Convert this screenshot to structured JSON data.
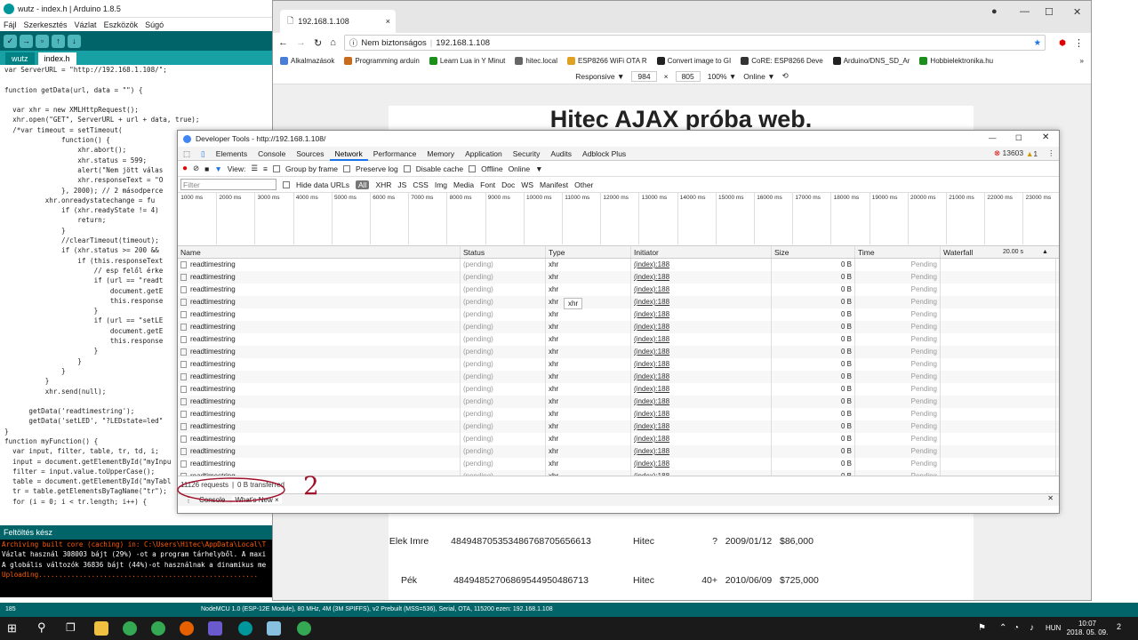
{
  "arduino": {
    "title": "wutz - index.h | Arduino 1.8.5",
    "menu": [
      "Fájl",
      "Szerkesztés",
      "Vázlat",
      "Eszközök",
      "Súgó"
    ],
    "tabs": [
      "wutz",
      "index.h"
    ],
    "code": [
      "var ServerURL = \"http://192.168.1.108/\";",
      "",
      "function getData(url, data = \"\") {",
      "",
      "  var xhr = new XMLHttpRequest();",
      "  xhr.open(\"GET\", ServerURL + url + data, true);",
      "  /*var timeout = setTimeout(",
      "              function() {",
      "                  xhr.abort();",
      "                  xhr.status = 599;",
      "                  alert(\"Nem jött válas",
      "                  xhr.responseText = \"O",
      "              }, 2000); // 2 másodperce",
      "          xhr.onreadystatechange = fu",
      "              if (xhr.readyState != 4)",
      "                  return;",
      "              }",
      "              //clearTimeout(timeout);",
      "              if (xhr.status >= 200 && ",
      "                  if (this.responseText",
      "                      // esp felől érke",
      "                      if (url == \"readt",
      "                          document.getE",
      "                          this.response",
      "                      }",
      "                      if (url == \"setLE",
      "                          document.getE",
      "                          this.response",
      "                      }",
      "                  }",
      "              }",
      "          }",
      "          xhr.send(null);",
      "",
      "      getData('readtimestring');",
      "      getData('setLED', \"?LEDstate=led\"",
      "}",
      "function myFunction() {",
      "  var input, filter, table, tr, td, i;",
      "  input = document.getElementById(\"myInpu",
      "  filter = input.value.toUpperCase();",
      "  table = document.getElementById(\"myTabl",
      "  tr = table.getElementsByTagName(\"tr\");",
      "  for (i = 0; i < tr.length; i++) {"
    ],
    "status_msg": "Feltöltés kész",
    "console": [
      "Archiving built core (caching) in: C:\\Users\\Hitec\\AppData\\Local\\T",
      "Vázlat használ 308003 bájt (29%) -ot a program tárhelyből. A maxi",
      "A globális változók 36836 bájt (44%)-ot használnak a dinamikus me",
      "Uploading......................................................"
    ],
    "line_no": "185",
    "board": "NodeMCU 1.0 (ESP-12E Module), 80 MHz, 4M (3M SPIFFS), v2 Prebuilt (MSS=536), Serial, OTA, 115200 ezen: 192.168.1.108"
  },
  "browser": {
    "tab_title": "192.168.1.108",
    "security": "Nem biztonságos",
    "url": "192.168.1.108",
    "bookmarks": [
      "Alkalmazások",
      "Programming arduin",
      "Learn Lua in Y Minut",
      "hitec.local",
      "ESP8266 WiFi OTA R",
      "Convert image to GI",
      "CoRE: ESP8266 Deve",
      "Arduino/DNS_SD_Ar",
      "Hobbielektronika.hu"
    ],
    "device": "Responsive ▼",
    "width": "984",
    "height": "805",
    "zoom": "100% ▼",
    "net": "Online ▼"
  },
  "site": {
    "heading": "Hitec AJAX próba web.",
    "rows": [
      {
        "name": "Elek Imre",
        "id": "484948705353486768705656613",
        "co": "Hitec",
        "age": "?",
        "date": "2009/01/12",
        "sal": "$86,000"
      },
      {
        "name": "Pék",
        "id": "48494852706869544950486713",
        "co": "Hitec",
        "age": "40+",
        "date": "2010/06/09",
        "sal": "$725,000"
      }
    ]
  },
  "devtools": {
    "title": "Developer Tools - http://192.168.1.108/",
    "tabs": [
      "Elements",
      "Console",
      "Sources",
      "Network",
      "Performance",
      "Memory",
      "Application",
      "Security",
      "Audits",
      "Adblock Plus"
    ],
    "errors": "13603",
    "warnings": "1",
    "view": "View:",
    "group": "Group by frame",
    "preserve": "Preserve log",
    "disable": "Disable cache",
    "offline": "Offline",
    "online": "Online",
    "filter_ph": "Filter",
    "hide": "Hide data URLs",
    "types": [
      "All",
      "XHR",
      "JS",
      "CSS",
      "Img",
      "Media",
      "Font",
      "Doc",
      "WS",
      "Manifest",
      "Other"
    ],
    "ticks": [
      "1000 ms",
      "2000 ms",
      "3000 ms",
      "4000 ms",
      "5000 ms",
      "6000 ms",
      "7000 ms",
      "8000 ms",
      "9000 ms",
      "10000 ms",
      "11000 ms",
      "12000 ms",
      "13000 ms",
      "14000 ms",
      "15000 ms",
      "16000 ms",
      "17000 ms",
      "18000 ms",
      "19000 ms",
      "20000 ms",
      "21000 ms",
      "22000 ms",
      "23000 ms"
    ],
    "cols": [
      "Name",
      "Status",
      "Type",
      "Initiator",
      "Size",
      "Time",
      "Waterfall"
    ],
    "wf_time": "20.00 s",
    "row": {
      "name": "readtimestring",
      "status": "(pending)",
      "type": "xhr",
      "init": "(index):188",
      "size": "0 B",
      "time": "Pending"
    },
    "row_count": 18,
    "tooltip": "xhr",
    "requests": "11126 requests",
    "transferred": "0 B transferred",
    "drawer": [
      "Console",
      "What's New ×"
    ],
    "annotation": "2"
  },
  "taskbar": {
    "lang": "HUN",
    "time": "10:07",
    "date": "2018. 05. 09.",
    "notif": "2"
  }
}
